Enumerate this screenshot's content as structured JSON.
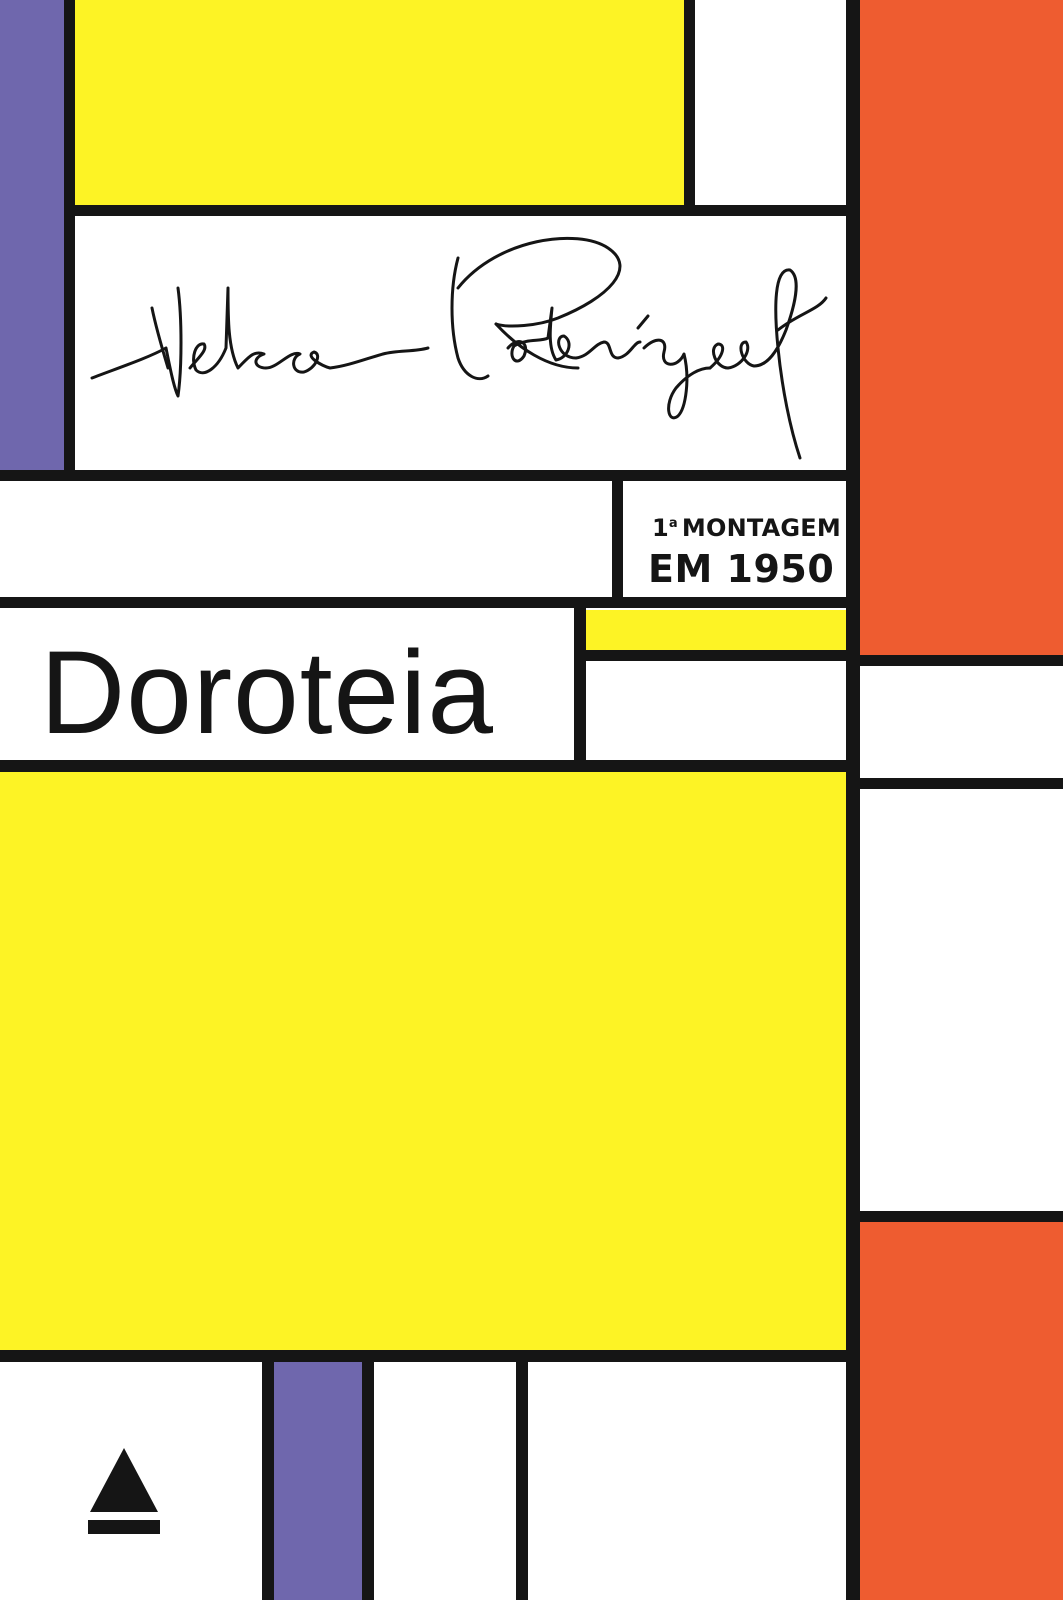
{
  "cover": {
    "author_signature": "Nelson Rodrigues",
    "badge": {
      "ordinal": "1",
      "ordinal_suffix": "a",
      "line1": "MONTAGEM",
      "line2": "EM 1950"
    },
    "title": "Doroteia",
    "publisher_logo": "triangle-logo-icon"
  },
  "colors": {
    "yellow": "#fdf325",
    "orange": "#ee5c30",
    "purple": "#6f67ad",
    "black": "#151515",
    "white": "#ffffff"
  }
}
